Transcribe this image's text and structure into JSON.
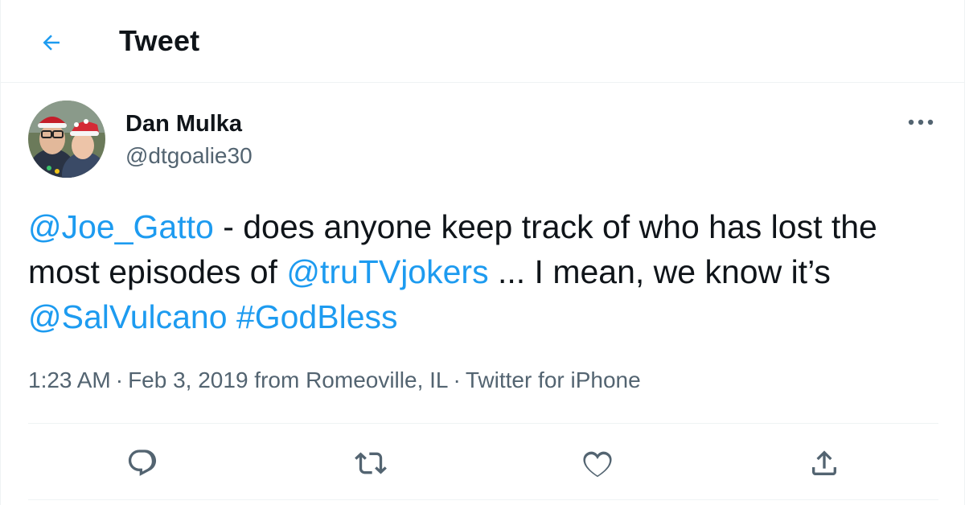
{
  "header": {
    "back_icon": "arrow-left-icon",
    "title": "Tweet"
  },
  "author": {
    "name": "Dan Mulka",
    "handle": "@dtgoalie30",
    "avatar_icon": "avatar-photo"
  },
  "tweet": {
    "segments": [
      {
        "text": "@Joe_Gatto",
        "link": true
      },
      {
        "text": " - does anyone keep track of who has lost the most episodes of ",
        "link": false
      },
      {
        "text": "@truTVjokers",
        "link": true
      },
      {
        "text": " ... I mean, we know it’s ",
        "link": false
      },
      {
        "text": "@SalVulcano",
        "link": true
      },
      {
        "text": " ",
        "link": false
      },
      {
        "text": "#GodBless",
        "link": true
      }
    ]
  },
  "meta": {
    "time": "1:23 AM",
    "date": "Feb 3, 2019",
    "location_prefix": "from",
    "location": "Romeoville, IL",
    "source": "Twitter for iPhone",
    "separator": "·"
  },
  "actions": [
    {
      "name": "reply",
      "icon": "reply-icon"
    },
    {
      "name": "retweet",
      "icon": "retweet-icon"
    },
    {
      "name": "like",
      "icon": "heart-icon"
    },
    {
      "name": "share",
      "icon": "share-icon"
    }
  ],
  "colors": {
    "accent": "#1d9bf0",
    "text": "#0f1419",
    "secondary": "#536471",
    "border": "#eff3f4"
  }
}
